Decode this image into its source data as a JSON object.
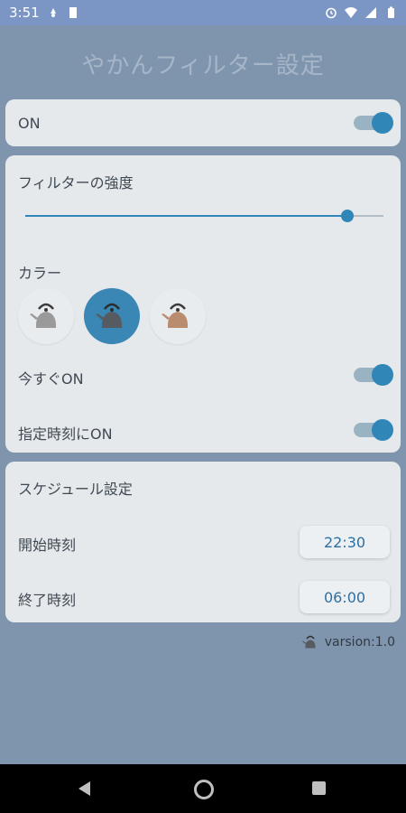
{
  "status_bar": {
    "time": "3:51",
    "icons_left": [
      "notification-icon",
      "sd-card-icon"
    ],
    "icons_right": [
      "alarm-icon",
      "wifi-icon",
      "signal-icon",
      "battery-icon"
    ]
  },
  "header": {
    "title": "やかんフィルター設定"
  },
  "power": {
    "label": "ON",
    "enabled": true
  },
  "filter": {
    "strength_label": "フィルターの強度",
    "strength_value": 0.9,
    "color_label": "カラー",
    "colors": [
      {
        "name": "gray-kettle-icon",
        "body": "#9a9a9a",
        "selected": false
      },
      {
        "name": "dark-kettle-icon",
        "body": "#555b61",
        "selected": true
      },
      {
        "name": "brown-kettle-icon",
        "body": "#b98c6e",
        "selected": false
      }
    ],
    "now_label": "今すぐON",
    "now_enabled": true,
    "scheduled_label": "指定時刻にON",
    "scheduled_enabled": true
  },
  "schedule": {
    "section_label": "スケジュール設定",
    "start_label": "開始時刻",
    "start_time": "22:30",
    "end_label": "終了時刻",
    "end_time": "06:00"
  },
  "footer": {
    "version_text": "varsion:1.0"
  },
  "colors": {
    "accent": "#2f86b7",
    "card": "#e6e9ec",
    "background": "#7f95ad"
  }
}
